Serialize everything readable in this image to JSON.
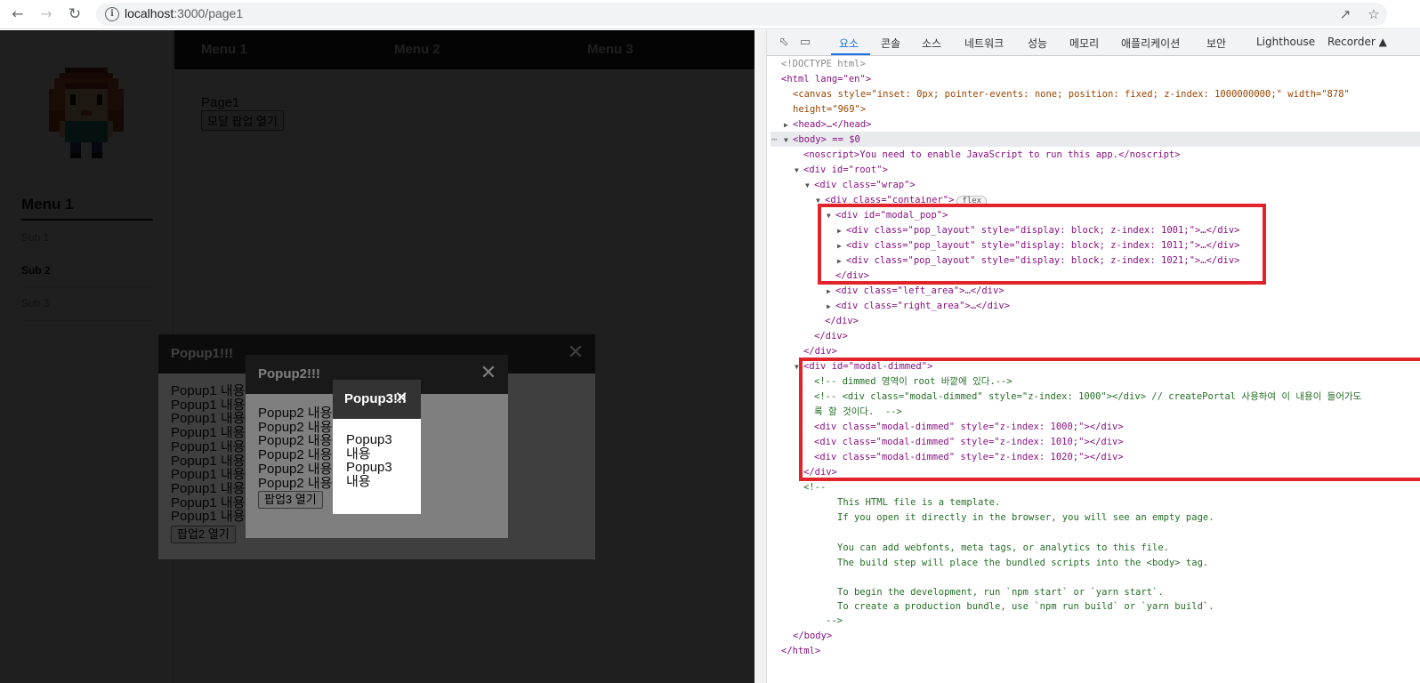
{
  "browser": {
    "url_host": "localhost",
    "url_path": ":3000/page1"
  },
  "app": {
    "menu_title": "Menu 1",
    "sub_items": [
      "Sub 1",
      "Sub 2",
      "Sub 3"
    ],
    "top_nav": [
      "Menu 1",
      "Menu 2",
      "Menu 3"
    ],
    "page_title": "Page1",
    "open_modal_button": "모달 팝업 열기"
  },
  "popups": [
    {
      "title": "Popup1!!!",
      "lines": [
        "Popup1 내용",
        "Popup1 내용",
        "Popup1 내용",
        "Popup1 내용",
        "Popup1 내용",
        "Popup1 내용",
        "Popup1 내용",
        "Popup1 내용",
        "Popup1 내용",
        "Popup1 내용"
      ],
      "button": "팝업2 열기"
    },
    {
      "title": "Popup2!!!",
      "lines": [
        "Popup2 내용",
        "Popup2 내용",
        "Popup2 내용",
        "Popup2 내용",
        "Popup2 내용",
        "Popup2 내용"
      ],
      "button": "팝업3 열기"
    },
    {
      "title": "Popup3!!!",
      "lines": [
        "Popup3",
        "내용",
        "Popup3",
        "내용"
      ]
    }
  ],
  "devtools": {
    "tabs": [
      "요소",
      "콘솔",
      "소스",
      "네트워크",
      "성능",
      "메모리",
      "애플리케이션",
      "보안",
      "Lighthouse",
      "Recorder"
    ],
    "active_tab": "요소",
    "flex_badge": "flex",
    "lines": [
      {
        "t": "<!DOCTYPE html>"
      },
      {
        "t": "<html lang=\"en\">"
      },
      {
        "t": "<canvas style=\"inset: 0px; pointer-events: none; position: fixed; z-index: 1000000000;\" width=\"878\""
      },
      {
        "t": "height=\"969\">"
      },
      {
        "t": "<head>…</head>"
      },
      {
        "t": "<body> == $0"
      },
      {
        "t": "<noscript>You need to enable JavaScript to run this app.</noscript>"
      },
      {
        "t": "<div id=\"root\">"
      },
      {
        "t": "<div class=\"wrap\">"
      },
      {
        "t": "<div class=\"container\">"
      },
      {
        "t": "<div id=\"modal_pop\">"
      },
      {
        "t": "<div class=\"pop_layout\" style=\"display: block; z-index: 1001;\">…</div>"
      },
      {
        "t": "<div class=\"pop_layout\" style=\"display: block; z-index: 1011;\">…</div>"
      },
      {
        "t": "<div class=\"pop_layout\" style=\"display: block; z-index: 1021;\">…</div>"
      },
      {
        "t": "</div>"
      },
      {
        "t": "<div class=\"left_area\">…</div>"
      },
      {
        "t": "<div class=\"right_area\">…</div>"
      },
      {
        "t": "</div>"
      },
      {
        "t": "</div>"
      },
      {
        "t": "</div>"
      },
      {
        "t": "<div id=\"modal-dimmed\">"
      },
      {
        "t": "<!-- dimmed 영역이 root 바깥에 있다.-->"
      },
      {
        "t": "<!-- <div class=\"modal-dimmed\" style=\"z-index: 1000\"></div> // createPortal 사용하여 이 내용이 들어가도"
      },
      {
        "t": "록 할 것이다.  -->"
      },
      {
        "t": "<div class=\"modal-dimmed\" style=\"z-index: 1000;\"></div>"
      },
      {
        "t": "<div class=\"modal-dimmed\" style=\"z-index: 1010;\"></div>"
      },
      {
        "t": "<div class=\"modal-dimmed\" style=\"z-index: 1020;\"></div>"
      },
      {
        "t": "</div>"
      },
      {
        "t": "<!--"
      },
      {
        "t": "This HTML file is a template."
      },
      {
        "t": "If you open it directly in the browser, you will see an empty page."
      },
      {
        "t": ""
      },
      {
        "t": "You can add webfonts, meta tags, or analytics to this file."
      },
      {
        "t": "The build step will place the bundled scripts into the <body> tag."
      },
      {
        "t": ""
      },
      {
        "t": "To begin the development, run `npm start` or `yarn start`."
      },
      {
        "t": "To create a production bundle, use `npm run build` or `yarn build`."
      },
      {
        "t": "-->"
      },
      {
        "t": "</body>"
      },
      {
        "t": "</html>"
      }
    ]
  },
  "colors": {
    "highlight_box": "#e1232b",
    "popup_header": "#333333",
    "top_nav": "#222222",
    "devtools_accent": "#1a73e8"
  }
}
